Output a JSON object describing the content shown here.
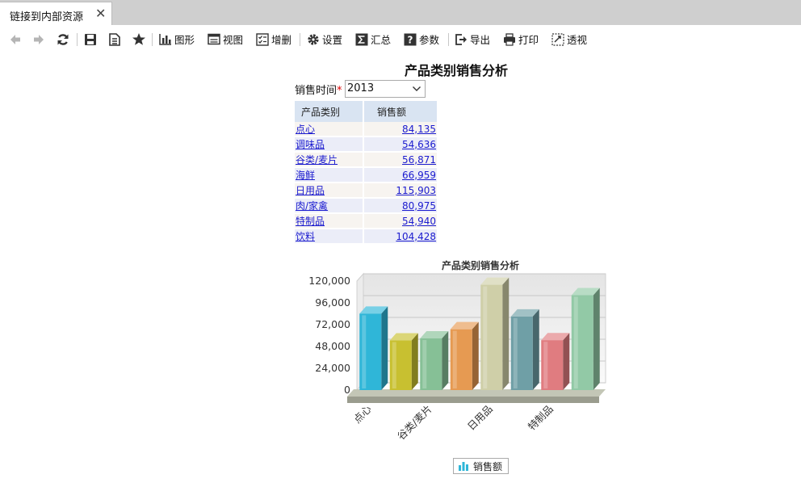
{
  "tab": {
    "title": "链接到内部资源"
  },
  "toolbar": {
    "chart_label": "图形",
    "view_label": "视图",
    "addremove_label": "增删",
    "settings_label": "设置",
    "summary_label": "汇总",
    "params_label": "参数",
    "export_label": "导出",
    "print_label": "打印",
    "pivot_label": "透视"
  },
  "report": {
    "title": "产品类别销售分析",
    "param_label": "销售时间",
    "param_required": "*",
    "param_value": "2013",
    "table": {
      "headers": [
        "产品类别",
        "销售额"
      ],
      "rows": [
        {
          "category": "点心",
          "amount": "84,135"
        },
        {
          "category": "调味品",
          "amount": "54,636"
        },
        {
          "category": "谷类/麦片",
          "amount": "56,871"
        },
        {
          "category": "海鲜",
          "amount": "66,959"
        },
        {
          "category": "日用品",
          "amount": "115,903"
        },
        {
          "category": "肉/家禽",
          "amount": "80,975"
        },
        {
          "category": "特制品",
          "amount": "54,940"
        },
        {
          "category": "饮料",
          "amount": "104,428"
        }
      ]
    }
  },
  "chart_data": {
    "type": "bar",
    "title": "产品类别销售分析",
    "categories": [
      "点心",
      "调味品",
      "谷类/麦片",
      "海鲜",
      "日用品",
      "肉/家禽",
      "特制品",
      "饮料"
    ],
    "x_tick_labels": [
      "点心",
      "",
      "谷类/麦片",
      "",
      "日用品",
      "",
      "特制品",
      ""
    ],
    "series": [
      {
        "name": "销售额",
        "values": [
          84135,
          54636,
          56871,
          66959,
          115903,
          80975,
          54940,
          104428
        ]
      }
    ],
    "ylim": [
      0,
      120000
    ],
    "yticks": [
      "0",
      "24,000",
      "48,000",
      "72,000",
      "96,000",
      "120,000"
    ],
    "ytick_values": [
      0,
      24000,
      48000,
      72000,
      96000,
      120000
    ],
    "grid": true,
    "legend_position": "bottom",
    "bar_colors": [
      "#2fb6d8",
      "#c8c030",
      "#86c096",
      "#e69a52",
      "#cfcfa8",
      "#6f9fa6",
      "#e07c80",
      "#92c9a6"
    ]
  }
}
